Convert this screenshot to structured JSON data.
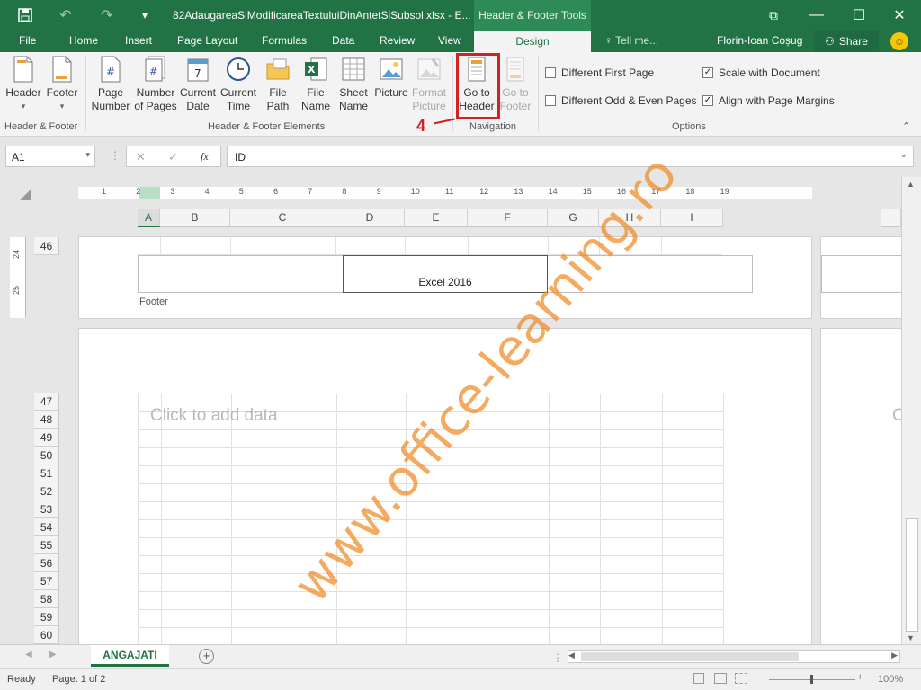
{
  "titlebar": {
    "filename": "82AdaugareaSiModificareaTextuluiDinAntetSiSubsol.xlsx - E...",
    "context_title": "Header & Footer Tools"
  },
  "tabs": [
    "File",
    "Home",
    "Insert",
    "Page Layout",
    "Formulas",
    "Data",
    "Review",
    "View"
  ],
  "active_tab": "Design",
  "tell_me": "Tell me...",
  "user": "Florin-Ioan Coșug",
  "share": "Share",
  "ribbon": {
    "header_footer": {
      "header_label": "Header",
      "footer_label": "Footer",
      "group_label": "Header & Footer"
    },
    "elements": {
      "page_number": [
        "Page",
        "Number"
      ],
      "number_of_pages": [
        "Number",
        "of Pages"
      ],
      "current_date": [
        "Current",
        "Date"
      ],
      "current_time": [
        "Current",
        "Time"
      ],
      "file_path": [
        "File",
        "Path"
      ],
      "file_name": [
        "File",
        "Name"
      ],
      "sheet_name": [
        "Sheet",
        "Name"
      ],
      "picture": "Picture",
      "format_picture": [
        "Format",
        "Picture"
      ],
      "group_label": "Header & Footer Elements"
    },
    "navigation": {
      "go_to_header": [
        "Go to",
        "Header"
      ],
      "go_to_footer": [
        "Go to",
        "Footer"
      ],
      "group_label": "Navigation"
    },
    "options": {
      "different_first_page": "Different First Page",
      "different_odd_even": "Different Odd & Even Pages",
      "scale_with_document": "Scale with Document",
      "align_with_margins": "Align with Page Margins",
      "group_label": "Options"
    },
    "annotation_number": "4"
  },
  "formula_bar": {
    "name_box": "A1",
    "formula": "ID",
    "fx": "fx"
  },
  "ruler_numbers": [
    "1",
    "2",
    "3",
    "4",
    "5",
    "6",
    "7",
    "8",
    "9",
    "10",
    "11",
    "12",
    "13",
    "14",
    "15",
    "16",
    "17",
    "18",
    "19"
  ],
  "columns": [
    "A",
    "B",
    "C",
    "D",
    "E",
    "F",
    "G",
    "H",
    "I"
  ],
  "vruler": [
    "24",
    "25"
  ],
  "rows_top": [
    "46"
  ],
  "footer_area": {
    "center_text": "Excel 2016",
    "label": "Footer"
  },
  "page2": {
    "placeholder": "Click to add data",
    "right_placeholder": "C"
  },
  "rows": [
    "47",
    "48",
    "49",
    "50",
    "51",
    "52",
    "53",
    "54",
    "55",
    "56",
    "57",
    "58",
    "59",
    "60"
  ],
  "sheet_tab": "ANGAJATI",
  "status": {
    "ready": "Ready",
    "page": "Page: 1 of 2",
    "zoom": "100%"
  },
  "watermark": "www.office-learning.ro"
}
